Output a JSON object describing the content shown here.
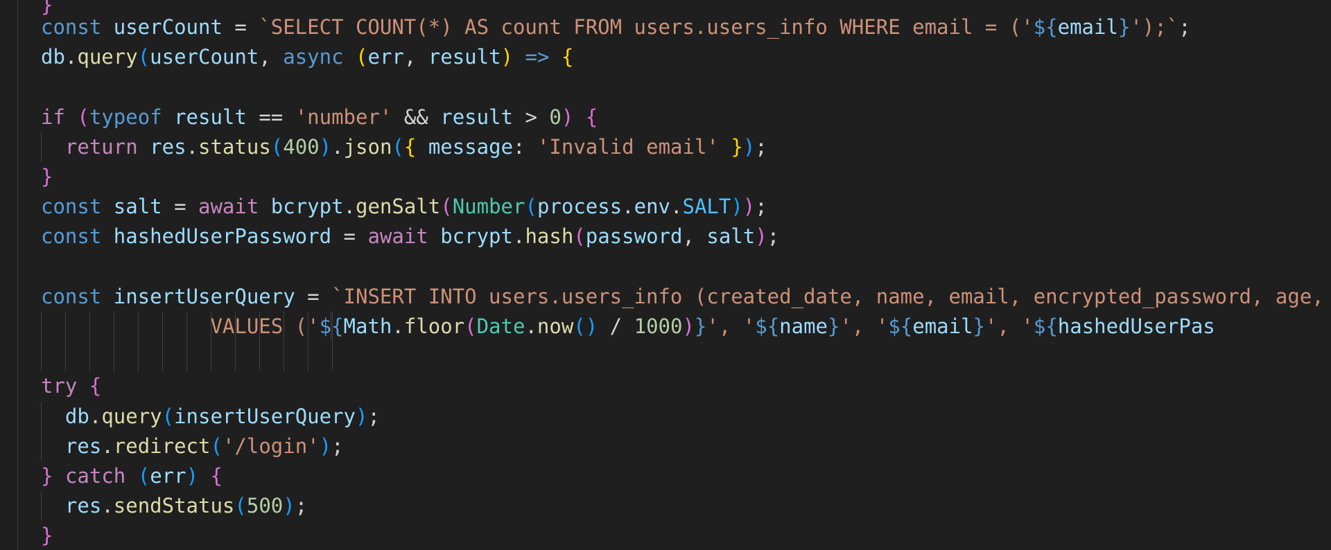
{
  "editor": {
    "colors": {
      "background": "#1f1f1f",
      "keyword": "#569cd6",
      "control": "#c586c0",
      "variable": "#9cdcfe",
      "constant": "#4fc1ff",
      "function": "#dcdcaa",
      "string": "#ce9178",
      "number": "#b5cea8",
      "operator": "#d4d4d4",
      "type": "#4ec9b0",
      "bracket_1": "#ffd700",
      "bracket_2": "#da70d6",
      "bracket_3": "#179fff"
    },
    "partial_top_line": "}",
    "lines": [
      [
        {
          "c": "kw",
          "t": "const "
        },
        {
          "c": "var",
          "t": "userCount"
        },
        {
          "c": "op",
          "t": " = "
        },
        {
          "c": "str",
          "t": "`SELECT COUNT(*) AS count FROM users.users_info WHERE email = ('"
        },
        {
          "c": "kw",
          "t": "${"
        },
        {
          "c": "var",
          "t": "email"
        },
        {
          "c": "kw",
          "t": "}"
        },
        {
          "c": "str",
          "t": "');`"
        },
        {
          "c": "op",
          "t": ";"
        }
      ],
      [
        {
          "c": "var",
          "t": "db"
        },
        {
          "c": "op",
          "t": "."
        },
        {
          "c": "fn",
          "t": "query"
        },
        {
          "c": "b3",
          "t": "("
        },
        {
          "c": "var",
          "t": "userCount"
        },
        {
          "c": "op",
          "t": ", "
        },
        {
          "c": "kw",
          "t": "async"
        },
        {
          "c": "op",
          "t": " "
        },
        {
          "c": "b1",
          "t": "("
        },
        {
          "c": "var",
          "t": "err"
        },
        {
          "c": "op",
          "t": ", "
        },
        {
          "c": "var",
          "t": "result"
        },
        {
          "c": "b1",
          "t": ")"
        },
        {
          "c": "op",
          "t": " "
        },
        {
          "c": "kw",
          "t": "=>"
        },
        {
          "c": "op",
          "t": " "
        },
        {
          "c": "b1",
          "t": "{"
        }
      ],
      [],
      [
        {
          "c": "ctl",
          "t": "if"
        },
        {
          "c": "op",
          "t": " "
        },
        {
          "c": "b2",
          "t": "("
        },
        {
          "c": "kw",
          "t": "typeof"
        },
        {
          "c": "op",
          "t": " "
        },
        {
          "c": "var",
          "t": "result"
        },
        {
          "c": "op",
          "t": " == "
        },
        {
          "c": "str",
          "t": "'number'"
        },
        {
          "c": "op",
          "t": " && "
        },
        {
          "c": "var",
          "t": "result"
        },
        {
          "c": "op",
          "t": " > "
        },
        {
          "c": "num",
          "t": "0"
        },
        {
          "c": "b2",
          "t": ")"
        },
        {
          "c": "op",
          "t": " "
        },
        {
          "c": "b2",
          "t": "{"
        }
      ],
      [
        {
          "c": "op",
          "t": "  "
        },
        {
          "c": "ctl",
          "t": "return"
        },
        {
          "c": "op",
          "t": " "
        },
        {
          "c": "var",
          "t": "res"
        },
        {
          "c": "op",
          "t": "."
        },
        {
          "c": "fn",
          "t": "status"
        },
        {
          "c": "b3",
          "t": "("
        },
        {
          "c": "num",
          "t": "400"
        },
        {
          "c": "b3",
          "t": ")"
        },
        {
          "c": "op",
          "t": "."
        },
        {
          "c": "fn",
          "t": "json"
        },
        {
          "c": "b3",
          "t": "("
        },
        {
          "c": "b1",
          "t": "{"
        },
        {
          "c": "op",
          "t": " "
        },
        {
          "c": "var",
          "t": "message"
        },
        {
          "c": "op",
          "t": ": "
        },
        {
          "c": "str",
          "t": "'Invalid email'"
        },
        {
          "c": "op",
          "t": " "
        },
        {
          "c": "b1",
          "t": "}"
        },
        {
          "c": "b3",
          "t": ")"
        },
        {
          "c": "op",
          "t": ";"
        }
      ],
      [
        {
          "c": "b2",
          "t": "}"
        }
      ],
      [
        {
          "c": "kw",
          "t": "const "
        },
        {
          "c": "var",
          "t": "salt"
        },
        {
          "c": "op",
          "t": " = "
        },
        {
          "c": "ctl",
          "t": "await"
        },
        {
          "c": "op",
          "t": " "
        },
        {
          "c": "var",
          "t": "bcrypt"
        },
        {
          "c": "op",
          "t": "."
        },
        {
          "c": "fn",
          "t": "genSalt"
        },
        {
          "c": "b2",
          "t": "("
        },
        {
          "c": "type",
          "t": "Number"
        },
        {
          "c": "b3",
          "t": "("
        },
        {
          "c": "var",
          "t": "process"
        },
        {
          "c": "op",
          "t": "."
        },
        {
          "c": "var",
          "t": "env"
        },
        {
          "c": "op",
          "t": "."
        },
        {
          "c": "const",
          "t": "SALT"
        },
        {
          "c": "b3",
          "t": ")"
        },
        {
          "c": "b2",
          "t": ")"
        },
        {
          "c": "op",
          "t": ";"
        }
      ],
      [
        {
          "c": "kw",
          "t": "const "
        },
        {
          "c": "var",
          "t": "hashedUserPassword"
        },
        {
          "c": "op",
          "t": " = "
        },
        {
          "c": "ctl",
          "t": "await"
        },
        {
          "c": "op",
          "t": " "
        },
        {
          "c": "var",
          "t": "bcrypt"
        },
        {
          "c": "op",
          "t": "."
        },
        {
          "c": "fn",
          "t": "hash"
        },
        {
          "c": "b2",
          "t": "("
        },
        {
          "c": "var",
          "t": "password"
        },
        {
          "c": "op",
          "t": ", "
        },
        {
          "c": "var",
          "t": "salt"
        },
        {
          "c": "b2",
          "t": ")"
        },
        {
          "c": "op",
          "t": ";"
        }
      ],
      [],
      [
        {
          "c": "kw",
          "t": "const "
        },
        {
          "c": "var",
          "t": "insertUserQuery"
        },
        {
          "c": "op",
          "t": " = "
        },
        {
          "c": "str",
          "t": "`INSERT INTO users.users_info (created_date, name, email, encrypted_password, age, s"
        }
      ],
      [
        {
          "c": "op",
          "t": "              "
        },
        {
          "c": "str",
          "t": "VALUES ('"
        },
        {
          "c": "kw",
          "t": "${"
        },
        {
          "c": "var",
          "t": "Math"
        },
        {
          "c": "op",
          "t": "."
        },
        {
          "c": "fn",
          "t": "floor"
        },
        {
          "c": "b2",
          "t": "("
        },
        {
          "c": "type",
          "t": "Date"
        },
        {
          "c": "op",
          "t": "."
        },
        {
          "c": "fn",
          "t": "now"
        },
        {
          "c": "b3",
          "t": "()"
        },
        {
          "c": "op",
          "t": " / "
        },
        {
          "c": "num",
          "t": "1000"
        },
        {
          "c": "b2",
          "t": ")"
        },
        {
          "c": "kw",
          "t": "}"
        },
        {
          "c": "str",
          "t": "', '"
        },
        {
          "c": "kw",
          "t": "${"
        },
        {
          "c": "var",
          "t": "name"
        },
        {
          "c": "kw",
          "t": "}"
        },
        {
          "c": "str",
          "t": "', '"
        },
        {
          "c": "kw",
          "t": "${"
        },
        {
          "c": "var",
          "t": "email"
        },
        {
          "c": "kw",
          "t": "}"
        },
        {
          "c": "str",
          "t": "', '"
        },
        {
          "c": "kw",
          "t": "${"
        },
        {
          "c": "var",
          "t": "hashedUserPas"
        }
      ],
      [],
      [
        {
          "c": "ctl",
          "t": "try"
        },
        {
          "c": "op",
          "t": " "
        },
        {
          "c": "b2",
          "t": "{"
        }
      ],
      [
        {
          "c": "op",
          "t": "  "
        },
        {
          "c": "var",
          "t": "db"
        },
        {
          "c": "op",
          "t": "."
        },
        {
          "c": "fn",
          "t": "query"
        },
        {
          "c": "b3",
          "t": "("
        },
        {
          "c": "var",
          "t": "insertUserQuery"
        },
        {
          "c": "b3",
          "t": ")"
        },
        {
          "c": "op",
          "t": ";"
        }
      ],
      [
        {
          "c": "op",
          "t": "  "
        },
        {
          "c": "var",
          "t": "res"
        },
        {
          "c": "op",
          "t": "."
        },
        {
          "c": "fn",
          "t": "redirect"
        },
        {
          "c": "b3",
          "t": "("
        },
        {
          "c": "str",
          "t": "'/login'"
        },
        {
          "c": "b3",
          "t": ")"
        },
        {
          "c": "op",
          "t": ";"
        }
      ],
      [
        {
          "c": "b2",
          "t": "}"
        },
        {
          "c": "op",
          "t": " "
        },
        {
          "c": "ctl",
          "t": "catch"
        },
        {
          "c": "op",
          "t": " "
        },
        {
          "c": "b3",
          "t": "("
        },
        {
          "c": "var",
          "t": "err"
        },
        {
          "c": "b3",
          "t": ")"
        },
        {
          "c": "op",
          "t": " "
        },
        {
          "c": "b2",
          "t": "{"
        }
      ],
      [
        {
          "c": "op",
          "t": "  "
        },
        {
          "c": "var",
          "t": "res"
        },
        {
          "c": "op",
          "t": "."
        },
        {
          "c": "fn",
          "t": "sendStatus"
        },
        {
          "c": "b3",
          "t": "("
        },
        {
          "c": "num",
          "t": "500"
        },
        {
          "c": "b3",
          "t": ")"
        },
        {
          "c": "op",
          "t": ";"
        }
      ],
      [
        {
          "c": "b2",
          "t": "}"
        }
      ]
    ]
  }
}
